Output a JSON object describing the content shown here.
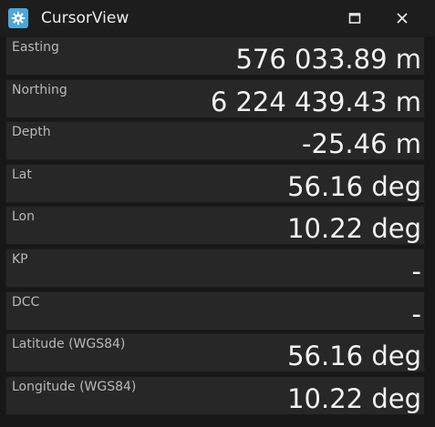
{
  "window": {
    "title": "CursorView",
    "icon": "app-gear-icon",
    "accent_color": "#4fa6d8"
  },
  "titlebar_buttons": {
    "maximize_icon": "maximize-icon",
    "close_icon": "close-icon"
  },
  "rows": [
    {
      "label": "Easting",
      "value": "576 033.89 m"
    },
    {
      "label": "Northing",
      "value": "6 224 439.43 m"
    },
    {
      "label": "Depth",
      "value": "-25.46 m"
    },
    {
      "label": "Lat",
      "value": "56.16 deg"
    },
    {
      "label": "Lon",
      "value": "10.22 deg"
    },
    {
      "label": "KP",
      "value": "-"
    },
    {
      "label": "DCC",
      "value": "-"
    },
    {
      "label": "Latitude (WGS84)",
      "value": "56.16 deg"
    },
    {
      "label": "Longitude (WGS84)",
      "value": "10.22 deg"
    }
  ]
}
